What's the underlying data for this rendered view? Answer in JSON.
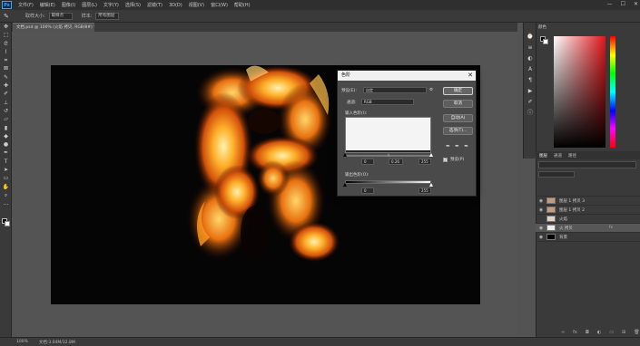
{
  "app": {
    "menu": [
      "文件(F)",
      "编辑(E)",
      "图像(I)",
      "图层(L)",
      "文字(Y)",
      "选择(S)",
      "滤镜(T)",
      "3D(D)",
      "视图(V)",
      "窗口(W)",
      "帮助(H)"
    ],
    "logo": "Ps",
    "window_controls": [
      "—",
      "☐",
      "✕"
    ]
  },
  "options_bar": {
    "tool_icon": "eyedropper-icon",
    "sample_label": "取样大小:",
    "sample_value": "取样点",
    "sample_label2": "样本:",
    "sample_value2": "所有图层"
  },
  "document": {
    "tab_label": "文档.psd @ 100% (火焰 拷贝, RGB/8#) *"
  },
  "status_bar": {
    "zoom": "100%",
    "doc_info": "文档:3.04M/32.8M"
  },
  "levels_dialog": {
    "title": "色阶",
    "close": "✕",
    "preset_label": "预设(E):",
    "preset_value": "自定",
    "channel_label": "通道:",
    "channel_value": "RGB",
    "input_levels_label": "输入色阶(I):",
    "input_black": "0",
    "input_gamma": "0.26",
    "input_white": "255",
    "output_levels_label": "输出色阶(O):",
    "output_black": "0",
    "output_white": "255",
    "buttons": {
      "ok": "确定",
      "cancel": "取消",
      "auto": "自动(A)",
      "options": "选项(T)..."
    },
    "preview_label": "预览(P)",
    "preview_checked": "✓",
    "gamma_position": 0.5
  },
  "panels": {
    "color_tab": "颜色",
    "layers_tabs": [
      "图层",
      "通道",
      "路径"
    ],
    "layers": [
      {
        "name": "",
        "selected": false
      },
      {
        "name": "图层 1 拷贝 3",
        "selected": false
      },
      {
        "name": "图层 1 拷贝 2",
        "selected": false
      },
      {
        "name": "火焰",
        "selected": false
      },
      {
        "name": "火 拷贝",
        "selected": true
      },
      {
        "name": "背景",
        "selected": false
      }
    ]
  }
}
